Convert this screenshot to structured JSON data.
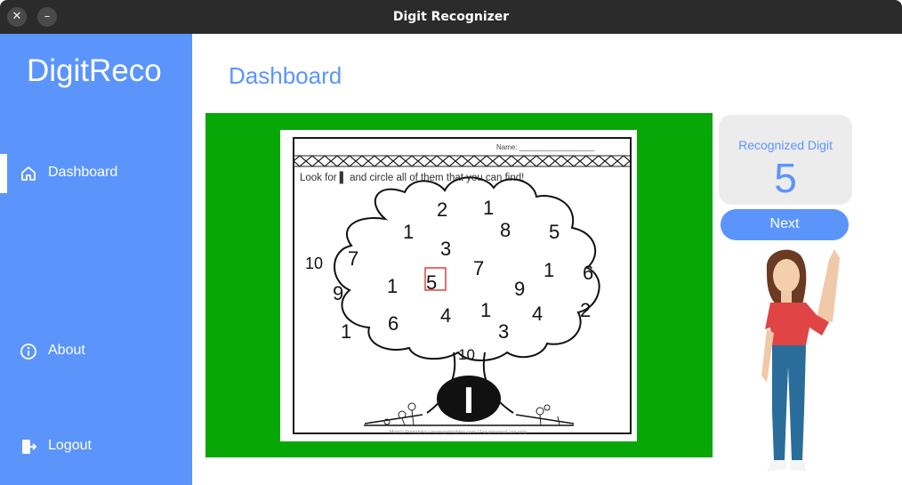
{
  "window": {
    "title": "Digit Recognizer",
    "close_glyph": "✕",
    "minimize_glyph": "–"
  },
  "sidebar": {
    "brand": "DigitReco",
    "items": [
      {
        "label": "Dashboard",
        "icon": "home-icon",
        "active": true
      },
      {
        "label": "About",
        "icon": "info-icon"
      },
      {
        "label": "Logout",
        "icon": "logout-icon"
      }
    ]
  },
  "main": {
    "title": "Dashboard"
  },
  "worksheet": {
    "name_label": "Name: ___________________",
    "instruction": "Look for ▌ and circle all of them that you can find!",
    "footer": "Mom's Printables | momsprintables.com | For personal use only",
    "target": "I",
    "digits": [
      "2",
      "1",
      "1",
      "8",
      "5",
      "3",
      "7",
      "7",
      "1",
      "6",
      "10",
      "9",
      "1",
      "5",
      "9",
      "1",
      "6",
      "4",
      "1",
      "4",
      "2",
      "3",
      "10"
    ]
  },
  "result": {
    "label": "Recognized Digit",
    "value": "5"
  },
  "next_button": {
    "label": "Next"
  },
  "colors": {
    "accent": "#5b95fb",
    "panel_green": "#07a707",
    "titlebar": "#2b2b2b",
    "highlight": "#d22"
  }
}
